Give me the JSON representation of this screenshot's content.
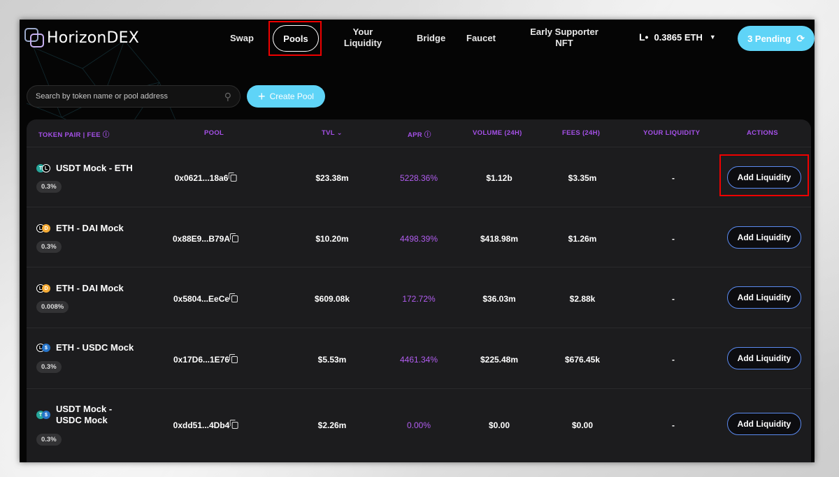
{
  "header": {
    "logo_text": "HorizonDEX",
    "nav": [
      "Swap",
      "Pools",
      "Your Liquidity",
      "Bridge",
      "Faucet",
      "Early Supporter NFT"
    ],
    "balance": "0.3865 ETH",
    "pending": "3 Pending"
  },
  "search": {
    "placeholder": "Search by token name or pool address"
  },
  "create_pool": "Create Pool",
  "table": {
    "columns": [
      "TOKEN PAIR | FEE",
      "POOL",
      "TVL",
      "APR",
      "VOLUME (24H)",
      "FEES (24H)",
      "YOUR LIQUIDITY",
      "ACTIONS"
    ],
    "rows": [
      {
        "pair": "USDT Mock - ETH",
        "fee": "0.3%",
        "pool": "0x0621...18a6",
        "tvl": "$23.38m",
        "apr": "5228.36%",
        "volume": "$1.12b",
        "fees": "$3.35m",
        "liquidity": "-",
        "action": "Add Liquidity"
      },
      {
        "pair": "ETH - DAI Mock",
        "fee": "0.3%",
        "pool": "0x88E9...B79A",
        "tvl": "$10.20m",
        "apr": "4498.39%",
        "volume": "$418.98m",
        "fees": "$1.26m",
        "liquidity": "-",
        "action": "Add Liquidity"
      },
      {
        "pair": "ETH - DAI Mock",
        "fee": "0.008%",
        "pool": "0x5804...EeCe",
        "tvl": "$609.08k",
        "apr": "172.72%",
        "volume": "$36.03m",
        "fees": "$2.88k",
        "liquidity": "-",
        "action": "Add Liquidity"
      },
      {
        "pair": "ETH - USDC Mock",
        "fee": "0.3%",
        "pool": "0x17D6...1E76",
        "tvl": "$5.53m",
        "apr": "4461.34%",
        "volume": "$225.48m",
        "fees": "$676.45k",
        "liquidity": "-",
        "action": "Add Liquidity"
      },
      {
        "pair_line1": "USDT Mock -",
        "pair_line2": "USDC Mock",
        "fee": "0.3%",
        "pool": "0xdd51...4Db4",
        "tvl": "$2.26m",
        "apr": "0.00%",
        "volume": "$0.00",
        "fees": "$0.00",
        "liquidity": "-",
        "action": "Add Liquidity"
      }
    ]
  },
  "colors": {
    "accent": "#5fd4f7",
    "apr": "#b15df0",
    "header_label": "#a550e8",
    "highlight": "#e00000"
  }
}
